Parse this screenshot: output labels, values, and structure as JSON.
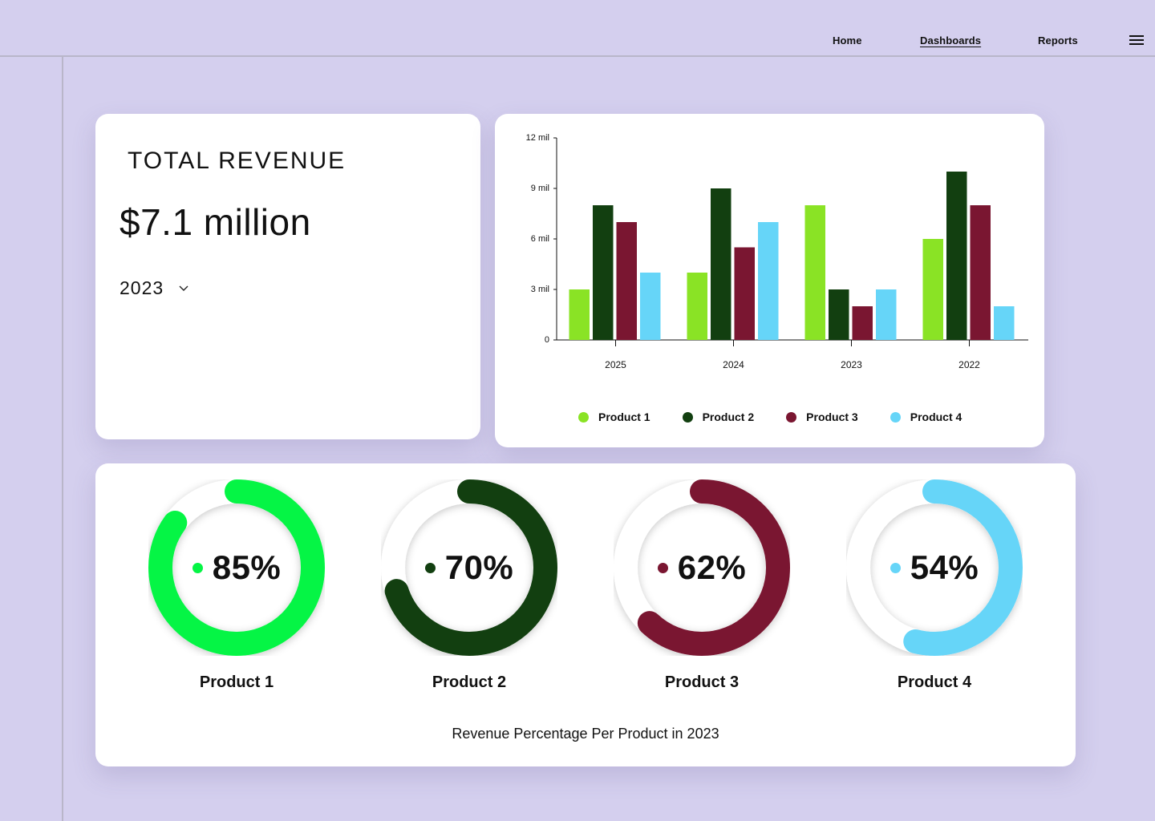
{
  "nav": {
    "home": "Home",
    "dashboards": "Dashboards",
    "reports": "Reports",
    "menu_icon": "hamburger-menu-icon"
  },
  "revenue": {
    "title": "TOTAL REVENUE",
    "value": "$7.1 million",
    "year": "2023",
    "dropdown_icon": "chevron-down-icon"
  },
  "chart_data": {
    "type": "bar",
    "categories": [
      "2025",
      "2024",
      "2023",
      "2022"
    ],
    "series": [
      {
        "name": "Product 1",
        "color": "#8ae325",
        "values": [
          3,
          4,
          8,
          6
        ]
      },
      {
        "name": "Product 2",
        "color": "#123f10",
        "values": [
          8,
          9,
          3,
          10
        ]
      },
      {
        "name": "Product 3",
        "color": "#7a1631",
        "values": [
          7,
          5.5,
          2,
          8
        ]
      },
      {
        "name": "Product 4",
        "color": "#66d5f8",
        "values": [
          4,
          7,
          3,
          2
        ]
      }
    ],
    "yticks": [
      0,
      3,
      6,
      9,
      12
    ],
    "ytick_labels": [
      "0",
      "3 mil",
      "6 mil",
      "9 mil",
      "12 mil"
    ],
    "ylim": [
      0,
      12
    ],
    "title": "",
    "xlabel": "",
    "ylabel": "",
    "legend_position": "bottom",
    "grid": false
  },
  "donuts": {
    "items": [
      {
        "label": "Product 1",
        "percent_text": "85%",
        "value": 85,
        "color": "#05f545"
      },
      {
        "label": "Product 2",
        "percent_text": "70%",
        "value": 70,
        "color": "#123f10"
      },
      {
        "label": "Product 3",
        "percent_text": "62%",
        "value": 62,
        "color": "#7a1631"
      },
      {
        "label": "Product 4",
        "percent_text": "54%",
        "value": 54,
        "color": "#66d5f8"
      }
    ],
    "caption": "Revenue Percentage Per Product in 2023"
  }
}
